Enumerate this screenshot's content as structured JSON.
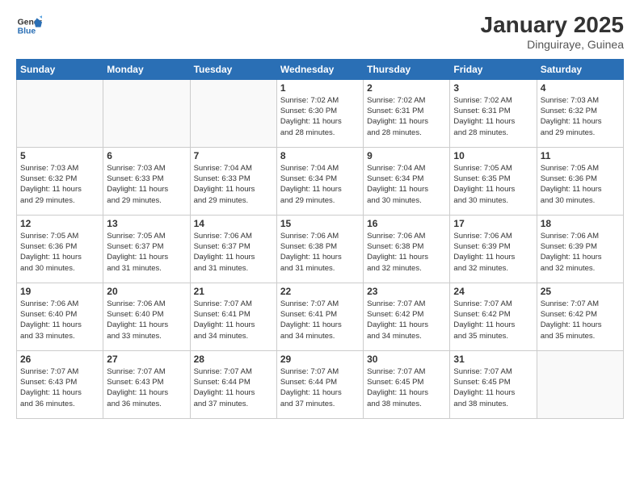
{
  "logo": {
    "general": "General",
    "blue": "Blue"
  },
  "header": {
    "title": "January 2025",
    "location": "Dinguiraye, Guinea"
  },
  "weekdays": [
    "Sunday",
    "Monday",
    "Tuesday",
    "Wednesday",
    "Thursday",
    "Friday",
    "Saturday"
  ],
  "weeks": [
    [
      {
        "day": "",
        "info": ""
      },
      {
        "day": "",
        "info": ""
      },
      {
        "day": "",
        "info": ""
      },
      {
        "day": "1",
        "info": "Sunrise: 7:02 AM\nSunset: 6:30 PM\nDaylight: 11 hours\nand 28 minutes."
      },
      {
        "day": "2",
        "info": "Sunrise: 7:02 AM\nSunset: 6:31 PM\nDaylight: 11 hours\nand 28 minutes."
      },
      {
        "day": "3",
        "info": "Sunrise: 7:02 AM\nSunset: 6:31 PM\nDaylight: 11 hours\nand 28 minutes."
      },
      {
        "day": "4",
        "info": "Sunrise: 7:03 AM\nSunset: 6:32 PM\nDaylight: 11 hours\nand 29 minutes."
      }
    ],
    [
      {
        "day": "5",
        "info": "Sunrise: 7:03 AM\nSunset: 6:32 PM\nDaylight: 11 hours\nand 29 minutes."
      },
      {
        "day": "6",
        "info": "Sunrise: 7:03 AM\nSunset: 6:33 PM\nDaylight: 11 hours\nand 29 minutes."
      },
      {
        "day": "7",
        "info": "Sunrise: 7:04 AM\nSunset: 6:33 PM\nDaylight: 11 hours\nand 29 minutes."
      },
      {
        "day": "8",
        "info": "Sunrise: 7:04 AM\nSunset: 6:34 PM\nDaylight: 11 hours\nand 29 minutes."
      },
      {
        "day": "9",
        "info": "Sunrise: 7:04 AM\nSunset: 6:34 PM\nDaylight: 11 hours\nand 30 minutes."
      },
      {
        "day": "10",
        "info": "Sunrise: 7:05 AM\nSunset: 6:35 PM\nDaylight: 11 hours\nand 30 minutes."
      },
      {
        "day": "11",
        "info": "Sunrise: 7:05 AM\nSunset: 6:36 PM\nDaylight: 11 hours\nand 30 minutes."
      }
    ],
    [
      {
        "day": "12",
        "info": "Sunrise: 7:05 AM\nSunset: 6:36 PM\nDaylight: 11 hours\nand 30 minutes."
      },
      {
        "day": "13",
        "info": "Sunrise: 7:05 AM\nSunset: 6:37 PM\nDaylight: 11 hours\nand 31 minutes."
      },
      {
        "day": "14",
        "info": "Sunrise: 7:06 AM\nSunset: 6:37 PM\nDaylight: 11 hours\nand 31 minutes."
      },
      {
        "day": "15",
        "info": "Sunrise: 7:06 AM\nSunset: 6:38 PM\nDaylight: 11 hours\nand 31 minutes."
      },
      {
        "day": "16",
        "info": "Sunrise: 7:06 AM\nSunset: 6:38 PM\nDaylight: 11 hours\nand 32 minutes."
      },
      {
        "day": "17",
        "info": "Sunrise: 7:06 AM\nSunset: 6:39 PM\nDaylight: 11 hours\nand 32 minutes."
      },
      {
        "day": "18",
        "info": "Sunrise: 7:06 AM\nSunset: 6:39 PM\nDaylight: 11 hours\nand 32 minutes."
      }
    ],
    [
      {
        "day": "19",
        "info": "Sunrise: 7:06 AM\nSunset: 6:40 PM\nDaylight: 11 hours\nand 33 minutes."
      },
      {
        "day": "20",
        "info": "Sunrise: 7:06 AM\nSunset: 6:40 PM\nDaylight: 11 hours\nand 33 minutes."
      },
      {
        "day": "21",
        "info": "Sunrise: 7:07 AM\nSunset: 6:41 PM\nDaylight: 11 hours\nand 34 minutes."
      },
      {
        "day": "22",
        "info": "Sunrise: 7:07 AM\nSunset: 6:41 PM\nDaylight: 11 hours\nand 34 minutes."
      },
      {
        "day": "23",
        "info": "Sunrise: 7:07 AM\nSunset: 6:42 PM\nDaylight: 11 hours\nand 34 minutes."
      },
      {
        "day": "24",
        "info": "Sunrise: 7:07 AM\nSunset: 6:42 PM\nDaylight: 11 hours\nand 35 minutes."
      },
      {
        "day": "25",
        "info": "Sunrise: 7:07 AM\nSunset: 6:42 PM\nDaylight: 11 hours\nand 35 minutes."
      }
    ],
    [
      {
        "day": "26",
        "info": "Sunrise: 7:07 AM\nSunset: 6:43 PM\nDaylight: 11 hours\nand 36 minutes."
      },
      {
        "day": "27",
        "info": "Sunrise: 7:07 AM\nSunset: 6:43 PM\nDaylight: 11 hours\nand 36 minutes."
      },
      {
        "day": "28",
        "info": "Sunrise: 7:07 AM\nSunset: 6:44 PM\nDaylight: 11 hours\nand 37 minutes."
      },
      {
        "day": "29",
        "info": "Sunrise: 7:07 AM\nSunset: 6:44 PM\nDaylight: 11 hours\nand 37 minutes."
      },
      {
        "day": "30",
        "info": "Sunrise: 7:07 AM\nSunset: 6:45 PM\nDaylight: 11 hours\nand 38 minutes."
      },
      {
        "day": "31",
        "info": "Sunrise: 7:07 AM\nSunset: 6:45 PM\nDaylight: 11 hours\nand 38 minutes."
      },
      {
        "day": "",
        "info": ""
      }
    ]
  ]
}
